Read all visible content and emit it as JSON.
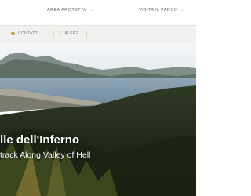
{
  "nav": {
    "area_label": "AREA PROTETTA",
    "visita_label": "VISITA IL PARCO"
  },
  "subnav": {
    "contatti_label": "CONTATTI",
    "alert_label": "ALERT"
  },
  "hero": {
    "title": "lle dell'Inferno",
    "subtitle": "track Along Valley of Hell"
  },
  "colors": {
    "accent": "#c5b24a",
    "subbar_bg": "#f1f1ef"
  },
  "icons": [
    "chevron-down-icon",
    "mail-icon",
    "alert-icon"
  ]
}
